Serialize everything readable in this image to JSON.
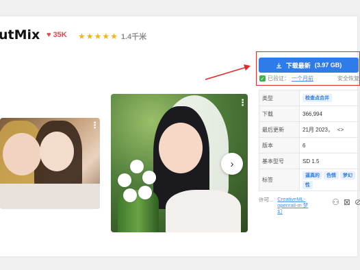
{
  "model": {
    "title": "utMix",
    "likes": "35K",
    "stars": [
      "★",
      "★",
      "★",
      "★",
      "★"
    ],
    "rating": "1.4千米"
  },
  "download": {
    "label": "下载最新",
    "size": "(3.97 GB)",
    "verified": "已验证：",
    "verified_when": "一个月前",
    "safe": "安全恢复"
  },
  "details": [
    {
      "key": "类型",
      "value": "",
      "tags": [
        "检查点合并"
      ]
    },
    {
      "key": "下载",
      "value": "366,994",
      "tags": []
    },
    {
      "key": "最后更新",
      "value": "21月 2023，",
      "extra": "<>",
      "tags": []
    },
    {
      "key": "版本",
      "value": "6",
      "tags": []
    },
    {
      "key": "基本型号",
      "value": "SD 1.5",
      "tags": []
    },
    {
      "key": "标签",
      "value": "",
      "tags": [
        "逼真的",
        "色情",
        "梦幻",
        "性"
      ]
    }
  ],
  "license": {
    "label": "许可...",
    "link": "CreativeML-openrail-m 梦幻"
  },
  "colors": {
    "accent": "#2f7bea",
    "highlight_box": "#e32a2a",
    "like": "#e8454f",
    "star": "#f6b314"
  },
  "icons": {
    "like": "heart-icon",
    "download": "download-icon",
    "verified": "check-icon",
    "next": "chevron-right-icon",
    "menu": "more-vertical-icon"
  }
}
